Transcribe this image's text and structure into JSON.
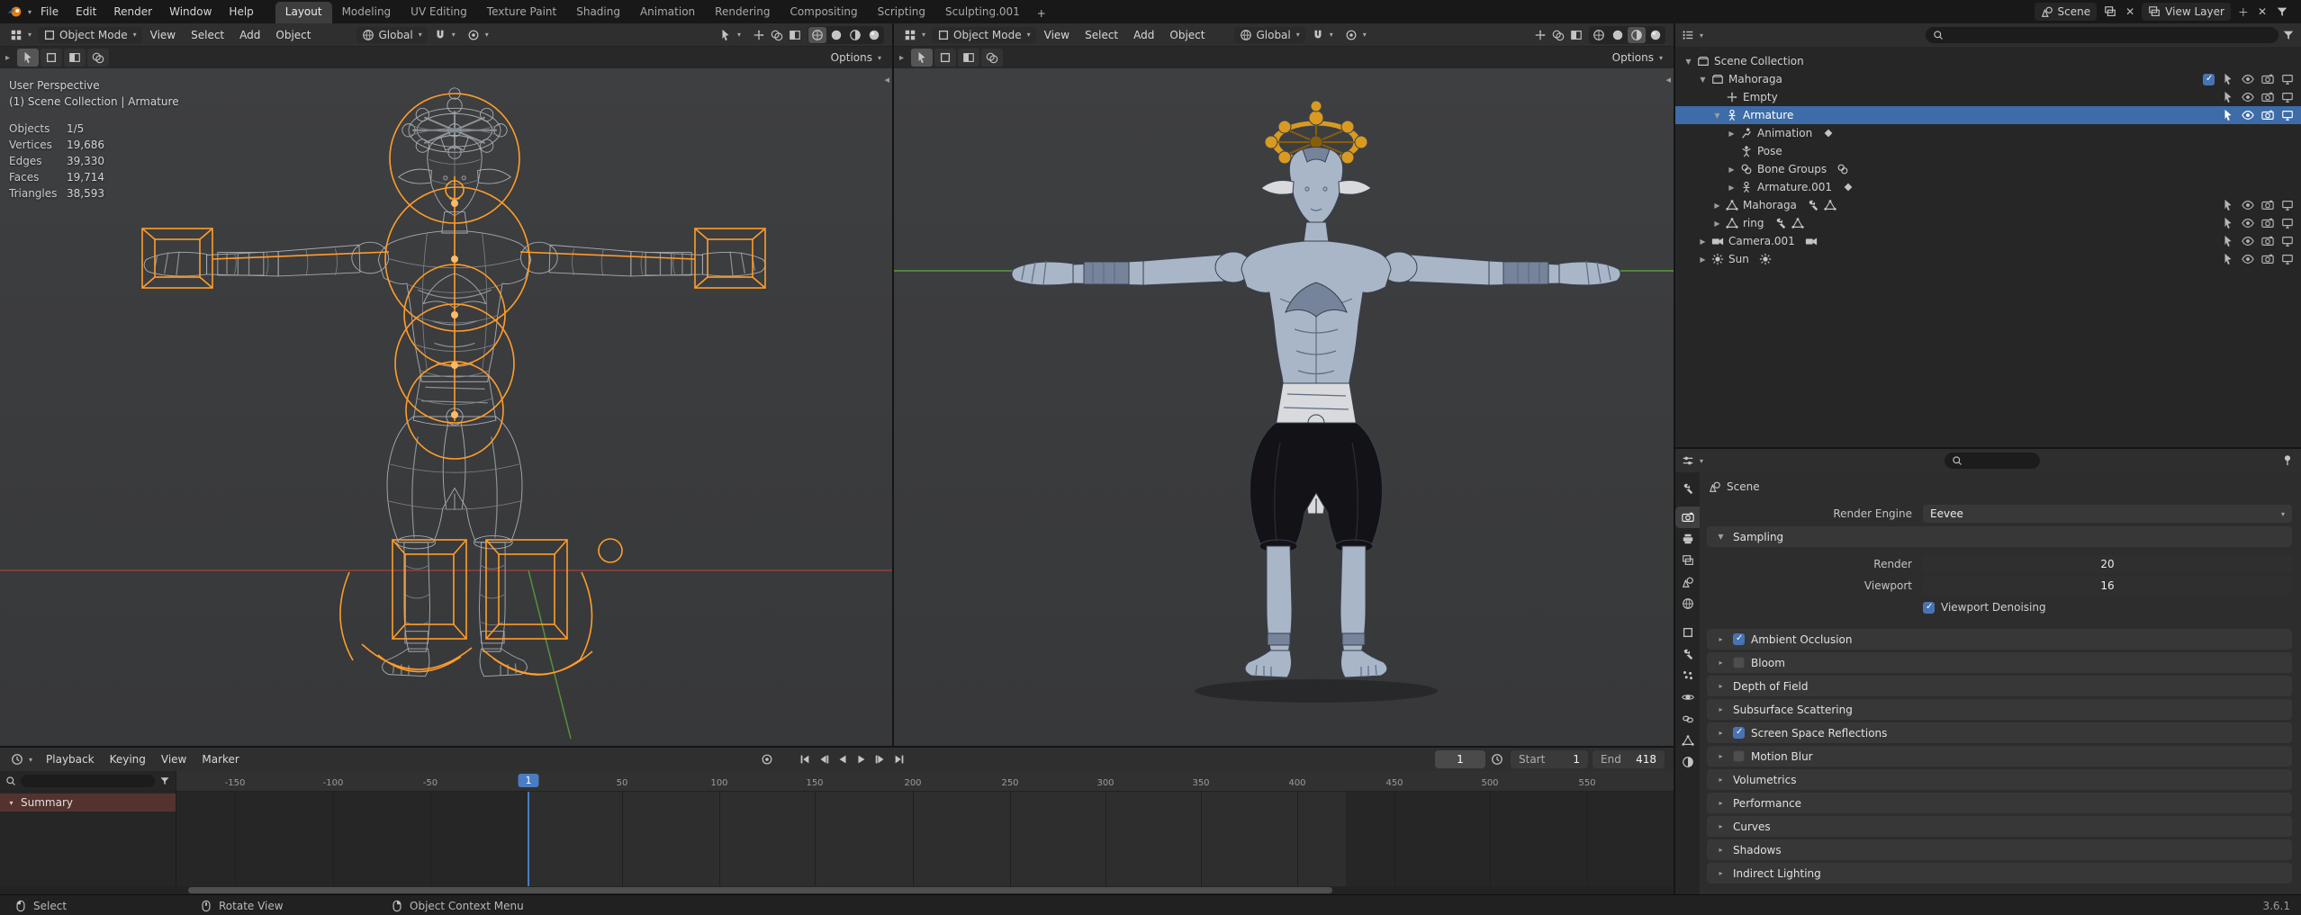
{
  "topbar": {
    "menus": [
      {
        "label": "File"
      },
      {
        "label": "Edit"
      },
      {
        "label": "Render"
      },
      {
        "label": "Window"
      },
      {
        "label": "Help"
      }
    ],
    "workspaces": [
      {
        "label": "Layout",
        "active": true
      },
      {
        "label": "Modeling",
        "active": false
      },
      {
        "label": "UV Editing",
        "active": false
      },
      {
        "label": "Texture Paint",
        "active": false
      },
      {
        "label": "Shading",
        "active": false
      },
      {
        "label": "Animation",
        "active": false
      },
      {
        "label": "Rendering",
        "active": false
      },
      {
        "label": "Compositing",
        "active": false
      },
      {
        "label": "Scripting",
        "active": false
      },
      {
        "label": "Sculpting.001",
        "active": false
      }
    ],
    "add_workspace": "+",
    "scene": "Scene",
    "view_layer": "View Layer"
  },
  "viewport_left": {
    "mode": "Object Mode",
    "menu_view": "View",
    "menu_select": "Select",
    "menu_add": "Add",
    "menu_object": "Object",
    "orientation": "Global",
    "options": "Options",
    "overlay": {
      "perspective": "User Perspective",
      "context": "(1) Scene Collection | Armature",
      "stats": [
        {
          "label": "Objects",
          "value": "1/5"
        },
        {
          "label": "Vertices",
          "value": "19,686"
        },
        {
          "label": "Edges",
          "value": "39,330"
        },
        {
          "label": "Faces",
          "value": "19,714"
        },
        {
          "label": "Triangles",
          "value": "38,593"
        }
      ]
    }
  },
  "viewport_right": {
    "mode": "Object Mode",
    "menu_view": "View",
    "menu_select": "Select",
    "menu_add": "Add",
    "menu_object": "Object",
    "orientation": "Global",
    "options": "Options"
  },
  "outliner": {
    "rows": [
      {
        "name": "Scene Collection"
      },
      {
        "name": "Mahoraga"
      },
      {
        "name": "Empty"
      },
      {
        "name": "Armature"
      },
      {
        "name": "Animation"
      },
      {
        "name": "Pose"
      },
      {
        "name": "Bone Groups"
      },
      {
        "name": "Armature.001"
      },
      {
        "name": "Mahoraga"
      },
      {
        "name": "ring"
      },
      {
        "name": "Camera.001"
      },
      {
        "name": "Sun"
      }
    ]
  },
  "properties": {
    "breadcrumb": "Scene",
    "render_engine_label": "Render Engine",
    "render_engine_value": "Eevee",
    "sampling": {
      "title": "Sampling",
      "render_label": "Render",
      "render_value": "20",
      "viewport_label": "Viewport",
      "viewport_value": "16",
      "denoising_label": "Viewport Denoising"
    },
    "sections": [
      {
        "label": "Ambient Occlusion",
        "checked": true
      },
      {
        "label": "Bloom",
        "checked": false
      },
      {
        "label": "Depth of Field"
      },
      {
        "label": "Subsurface Scattering"
      },
      {
        "label": "Screen Space Reflections",
        "checked": true
      },
      {
        "label": "Motion Blur",
        "checked": false
      },
      {
        "label": "Volumetrics"
      },
      {
        "label": "Performance"
      },
      {
        "label": "Curves"
      },
      {
        "label": "Shadows"
      },
      {
        "label": "Indirect Lighting"
      }
    ]
  },
  "timeline": {
    "menus": [
      "Playback",
      "Keying",
      "View",
      "Marker"
    ],
    "current_frame": "1",
    "playhead": "1",
    "start_label": "Start",
    "start_value": "1",
    "end_label": "End",
    "end_value": "418",
    "summary": "Summary",
    "ruler": [
      "-150",
      "-100",
      "-50",
      "50",
      "100",
      "150",
      "200",
      "250",
      "300",
      "350",
      "400",
      "450",
      "500",
      "550"
    ]
  },
  "statusbar": {
    "select": "Select",
    "rotate": "Rotate View",
    "context_menu": "Object Context Menu",
    "version": "3.6.1"
  }
}
